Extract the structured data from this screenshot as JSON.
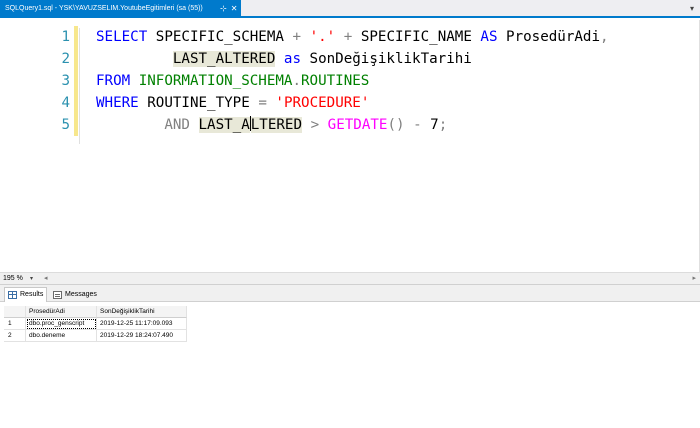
{
  "tab": {
    "title": "SQLQuery1.sql - YSK\\YAVUZSELIM.YoutubeEgitimleri (sa (55))",
    "pin_glyph": "⊹",
    "close_glyph": "✕",
    "dropdown_glyph": "▾"
  },
  "editor": {
    "line_numbers": [
      "1",
      "2",
      "3",
      "4",
      "5"
    ],
    "lines": [
      [
        {
          "t": "kw",
          "v": "SELECT"
        },
        {
          "t": "id",
          "v": " SPECIFIC_SCHEMA "
        },
        {
          "t": "op",
          "v": "+"
        },
        {
          "t": "id",
          "v": " "
        },
        {
          "t": "str",
          "v": "'.'"
        },
        {
          "t": "id",
          "v": " "
        },
        {
          "t": "op",
          "v": "+"
        },
        {
          "t": "id",
          "v": " SPECIFIC_NAME "
        },
        {
          "t": "kw",
          "v": "AS"
        },
        {
          "t": "id",
          "v": " ProsedürAdi"
        },
        {
          "t": "op",
          "v": ","
        }
      ],
      [
        {
          "t": "id",
          "v": "         "
        },
        {
          "t": "id hl",
          "v": "LAST_ALTERED"
        },
        {
          "t": "id",
          "v": " "
        },
        {
          "t": "kw",
          "v": "as"
        },
        {
          "t": "id",
          "v": " SonDeğişiklikTarihi"
        }
      ],
      [
        {
          "t": "kw",
          "v": "FROM"
        },
        {
          "t": "id",
          "v": " "
        },
        {
          "t": "sys",
          "v": "INFORMATION_SCHEMA"
        },
        {
          "t": "op",
          "v": "."
        },
        {
          "t": "sys",
          "v": "ROUTINES"
        }
      ],
      [
        {
          "t": "kw",
          "v": "WHERE"
        },
        {
          "t": "id",
          "v": " ROUTINE_TYPE "
        },
        {
          "t": "op",
          "v": "="
        },
        {
          "t": "id",
          "v": " "
        },
        {
          "t": "str",
          "v": "'PROCEDURE'"
        }
      ],
      [
        {
          "t": "id",
          "v": "        "
        },
        {
          "t": "op",
          "v": "AND"
        },
        {
          "t": "id",
          "v": " "
        },
        {
          "t": "id hl",
          "v": "LAST_A"
        },
        {
          "t": "caret",
          "v": ""
        },
        {
          "t": "id hl",
          "v": "LTERED"
        },
        {
          "t": "id",
          "v": " "
        },
        {
          "t": "op",
          "v": ">"
        },
        {
          "t": "id",
          "v": " "
        },
        {
          "t": "fn",
          "v": "GETDATE"
        },
        {
          "t": "op",
          "v": "()"
        },
        {
          "t": "id",
          "v": " "
        },
        {
          "t": "op",
          "v": "-"
        },
        {
          "t": "id",
          "v": " 7"
        },
        {
          "t": "op",
          "v": ";"
        }
      ]
    ]
  },
  "zoom": {
    "value": "195 %",
    "dropdown_glyph": "▾",
    "scroll_left_glyph": "◂",
    "scroll_right_glyph": "▸"
  },
  "results": {
    "tabs": [
      {
        "label": "Results"
      },
      {
        "label": "Messages"
      }
    ],
    "columns": [
      "",
      "ProsedürAdi",
      "SonDeğişiklikTarihi"
    ],
    "rows": [
      [
        "1",
        "dbo.proc_genscript",
        "2019-12-25 11:17:09.093"
      ],
      [
        "2",
        "dbo.deneme",
        "2019-12-29 18:24:07.490"
      ]
    ]
  }
}
